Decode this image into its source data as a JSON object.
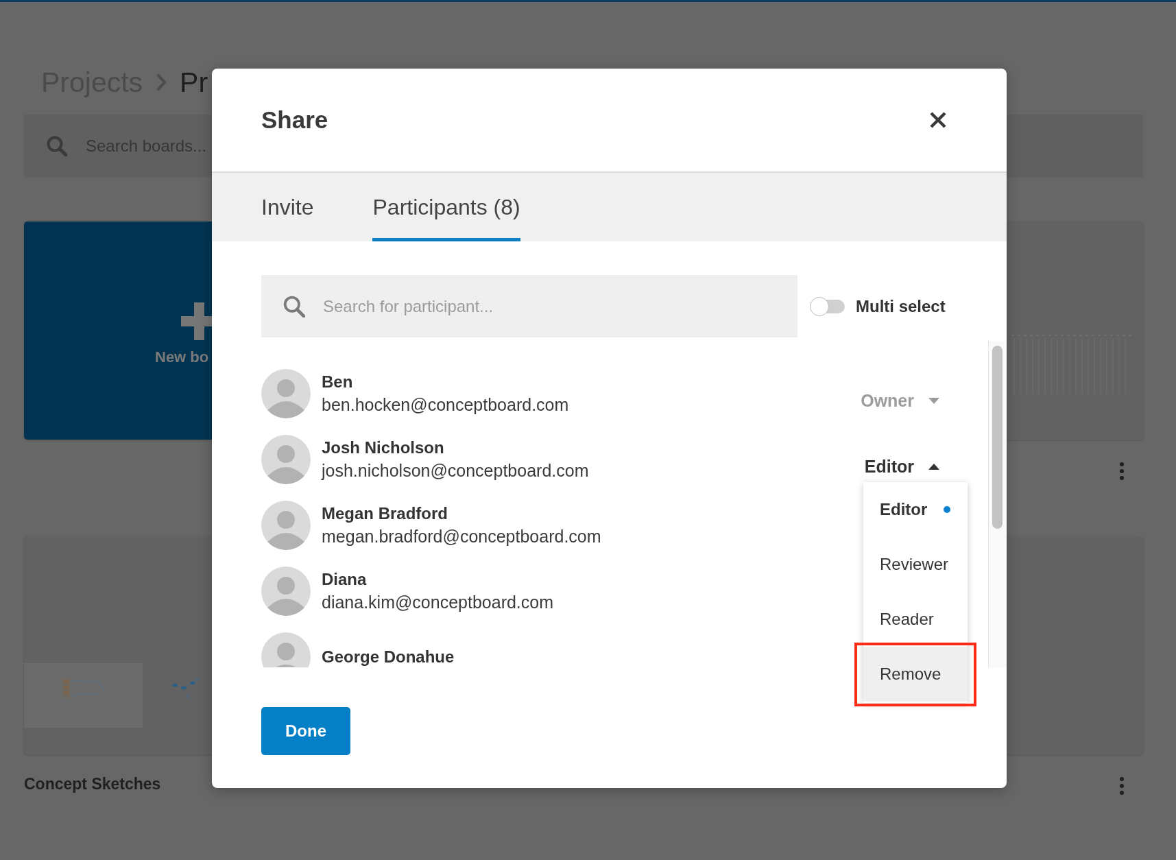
{
  "page": {
    "breadcrumb": [
      {
        "label": "Projects",
        "current": false
      },
      {
        "label": "Pr",
        "current": true
      }
    ],
    "search": {
      "placeholder": "Search boards..."
    },
    "new_board": {
      "label": "New bo"
    },
    "boards": [
      {
        "kind": "grid",
        "menu": true
      },
      {
        "kind": "sketches",
        "title": "Concept Sketches"
      },
      {
        "kind": "blank",
        "menu": true
      }
    ]
  },
  "dialog": {
    "title": "Share",
    "tabs": [
      {
        "label": "Invite",
        "selected": false
      },
      {
        "label": "Participants (8)",
        "selected": true
      }
    ],
    "search": {
      "placeholder": "Search for participant..."
    },
    "multi_select": {
      "label": "Multi select",
      "on": false
    },
    "participants": [
      {
        "name": "Ben",
        "email": "ben.hocken@conceptboard.com",
        "role": {
          "label": "Owner",
          "disabled": true,
          "expanded": false
        }
      },
      {
        "name": "Josh Nicholson",
        "email": "josh.nicholson@conceptboard.com",
        "role": {
          "label": "Editor",
          "disabled": false,
          "expanded": true,
          "options": [
            {
              "label": "Editor",
              "selected": true,
              "hovered": false,
              "annotated": false
            },
            {
              "label": "Reviewer",
              "selected": false,
              "hovered": false,
              "annotated": false
            },
            {
              "label": "Reader",
              "selected": false,
              "hovered": false,
              "annotated": false
            },
            {
              "label": "Remove",
              "selected": false,
              "hovered": true,
              "annotated": true
            }
          ]
        }
      },
      {
        "name": "Megan Bradford",
        "email": "megan.bradford@conceptboard.com"
      },
      {
        "name": "Diana",
        "email": "diana.kim@conceptboard.com"
      },
      {
        "name": "George Donahue"
      }
    ],
    "done_button": {
      "label": "Done"
    }
  }
}
